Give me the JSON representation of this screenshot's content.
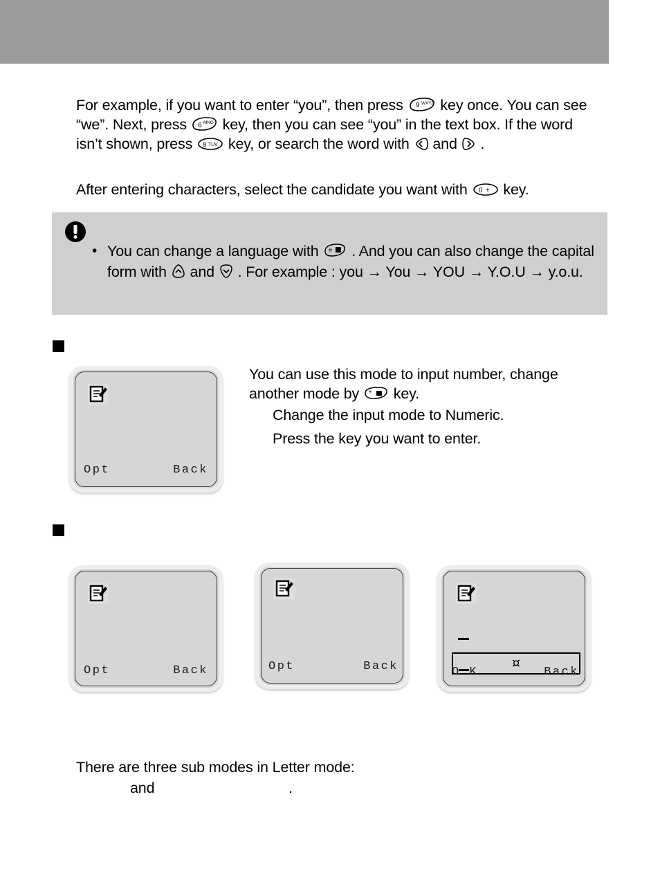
{
  "header": {
    "band_color": "#9b9b9b"
  },
  "paragraphs": {
    "example_p1": "For example, if you want to enter “you”, then press",
    "example_p2": "key once. You can see “we”. Next, press",
    "example_p3": "key, then you can see “you” in the text box. If the word isn’t shown, press",
    "example_p4": "key, or search the word with",
    "example_p5": "and",
    "example_p6": ".",
    "after_entering_1": "After entering characters, select the candidate you want with",
    "after_entering_2": "key."
  },
  "note": {
    "icon": "exclamation-circle-icon",
    "bullet": "•",
    "text_1": "You can change a language with",
    "text_2": ". And you can also change the capital form with",
    "text_3": "and",
    "text_4": ".  For example : you → You → YOU → Y.O.U → y.o.u."
  },
  "section_numeric": {
    "bullet": "square-bullet",
    "screen": {
      "icon": "note-edit-icon",
      "softkey_left": "Opt",
      "softkey_right": "Back"
    },
    "desc_1": "You can use this mode to input number, change another mode by",
    "desc_2": "key.",
    "step_1": "Change the input mode to Numeric.",
    "step_2": "Press the key you want to enter."
  },
  "section_letter": {
    "bullet": "square-bullet",
    "screens": [
      {
        "icon": "note-edit-icon",
        "softkey_left": "Opt",
        "softkey_right": "Back"
      },
      {
        "icon": "note-edit-icon",
        "softkey_left": "Opt",
        "softkey_right": "Back"
      },
      {
        "icon": "note-edit-icon",
        "softkey_left": "O K",
        "softkey_right": "Back",
        "input_symbol": "¤"
      }
    ]
  },
  "bottom": {
    "line1": "There are three sub modes in Letter mode:",
    "line2_a": "and",
    "line2_b": "."
  },
  "keys": {
    "key9": {
      "digit": "9",
      "letters": "WXYZ"
    },
    "key6": {
      "digit": "6",
      "letters": "MNO"
    },
    "key8": {
      "digit": "8",
      "letters": "TUV"
    },
    "key0": {
      "digit": "0",
      "letters": "+"
    },
    "key_hash": {
      "digit": "#",
      "letters": " "
    },
    "key_star": {
      "digit": "*",
      "letters": " "
    },
    "nav_left": "nav-left-key",
    "nav_right": "nav-right-key",
    "nav_up": "nav-up-key",
    "nav_down": "nav-down-key"
  },
  "colors": {
    "header_gray": "#9b9b9b",
    "note_gray": "#cfcfcf",
    "screen_gray": "#d6d6d6",
    "bezel_gray": "#ededed"
  }
}
